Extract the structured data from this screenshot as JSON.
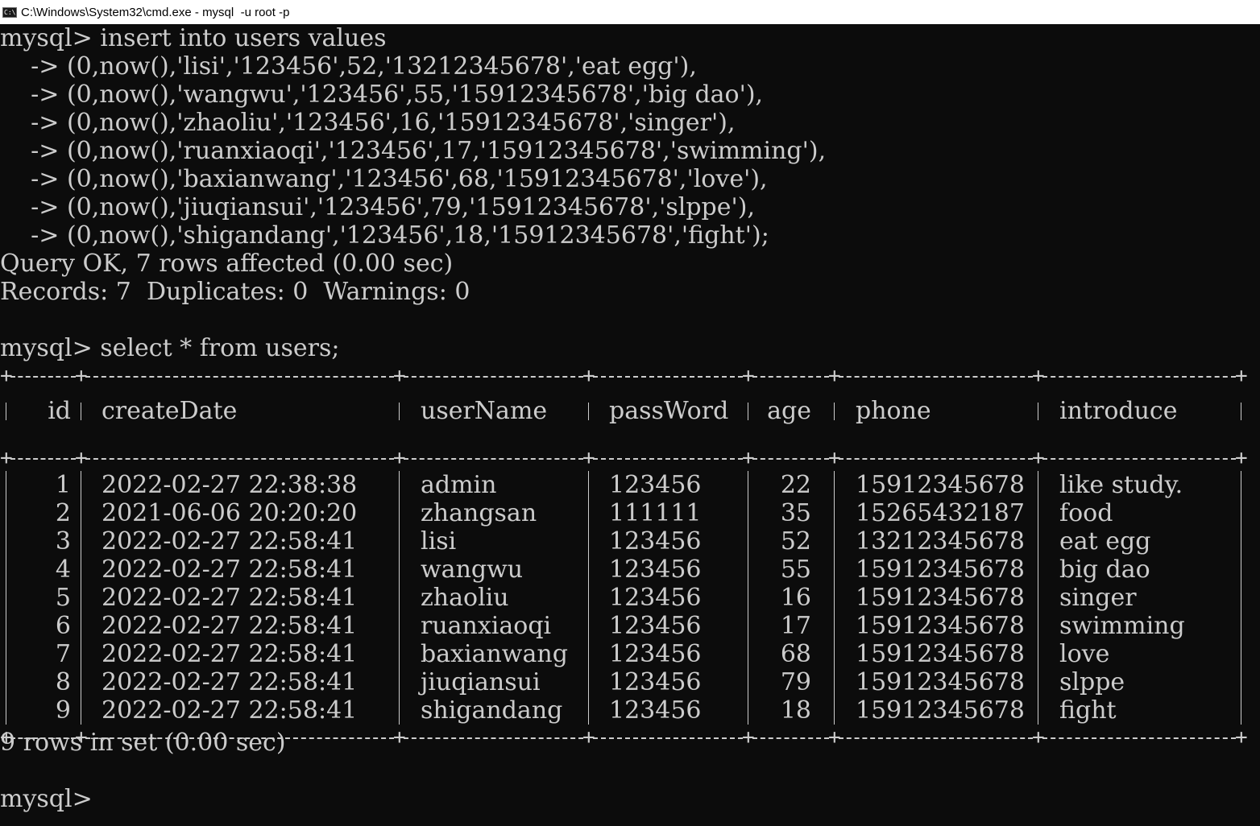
{
  "window": {
    "title": "C:\\Windows\\System32\\cmd.exe - mysql  -u root -p",
    "icon": "cmd-icon"
  },
  "console": {
    "insert_lines": [
      "mysql> insert into users values",
      "    -> (0,now(),'lisi','123456',52,'13212345678','eat egg'),",
      "    -> (0,now(),'wangwu','123456',55,'15912345678','big dao'),",
      "    -> (0,now(),'zhaoliu','123456',16,'15912345678','singer'),",
      "    -> (0,now(),'ruanxiaoqi','123456',17,'15912345678','swimming'),",
      "    -> (0,now(),'baxianwang','123456',68,'15912345678','love'),",
      "    -> (0,now(),'jiuqiansui','123456',79,'15912345678','slppe'),",
      "    -> (0,now(),'shigandang','123456',18,'15912345678','fight');"
    ],
    "query_ok": "Query OK, 7 rows affected (0.00 sec)",
    "records": "Records: 7  Duplicates: 0  Warnings: 0",
    "select_cmd": "mysql> select * from users;",
    "result_summary": "9 rows in set (0.00 sec)",
    "prompt": "mysql>"
  },
  "table": {
    "headers": [
      "id",
      "createDate",
      "userName",
      "passWord",
      "age",
      "phone",
      "introduce"
    ],
    "rows": [
      [
        "1",
        "2022-02-27 22:38:38",
        "admin",
        "123456",
        "22",
        "15912345678",
        "like study."
      ],
      [
        "2",
        "2021-06-06 20:20:20",
        "zhangsan",
        "111111",
        "35",
        "15265432187",
        "food"
      ],
      [
        "3",
        "2022-02-27 22:58:41",
        "lisi",
        "123456",
        "52",
        "13212345678",
        "eat egg"
      ],
      [
        "4",
        "2022-02-27 22:58:41",
        "wangwu",
        "123456",
        "55",
        "15912345678",
        "big dao"
      ],
      [
        "5",
        "2022-02-27 22:58:41",
        "zhaoliu",
        "123456",
        "16",
        "15912345678",
        "singer"
      ],
      [
        "6",
        "2022-02-27 22:58:41",
        "ruanxiaoqi",
        "123456",
        "17",
        "15912345678",
        "swimming"
      ],
      [
        "7",
        "2022-02-27 22:58:41",
        "baxianwang",
        "123456",
        "68",
        "15912345678",
        "love"
      ],
      [
        "8",
        "2022-02-27 22:58:41",
        "jiuqiansui",
        "123456",
        "79",
        "15912345678",
        "slppe"
      ],
      [
        "9",
        "2022-02-27 22:58:41",
        "shigandang",
        "123456",
        "18",
        "15912345678",
        "fight"
      ]
    ]
  },
  "colors": {
    "background": "#0c0c0c",
    "foreground": "#cccccc",
    "titlebar": "#ffffff"
  }
}
